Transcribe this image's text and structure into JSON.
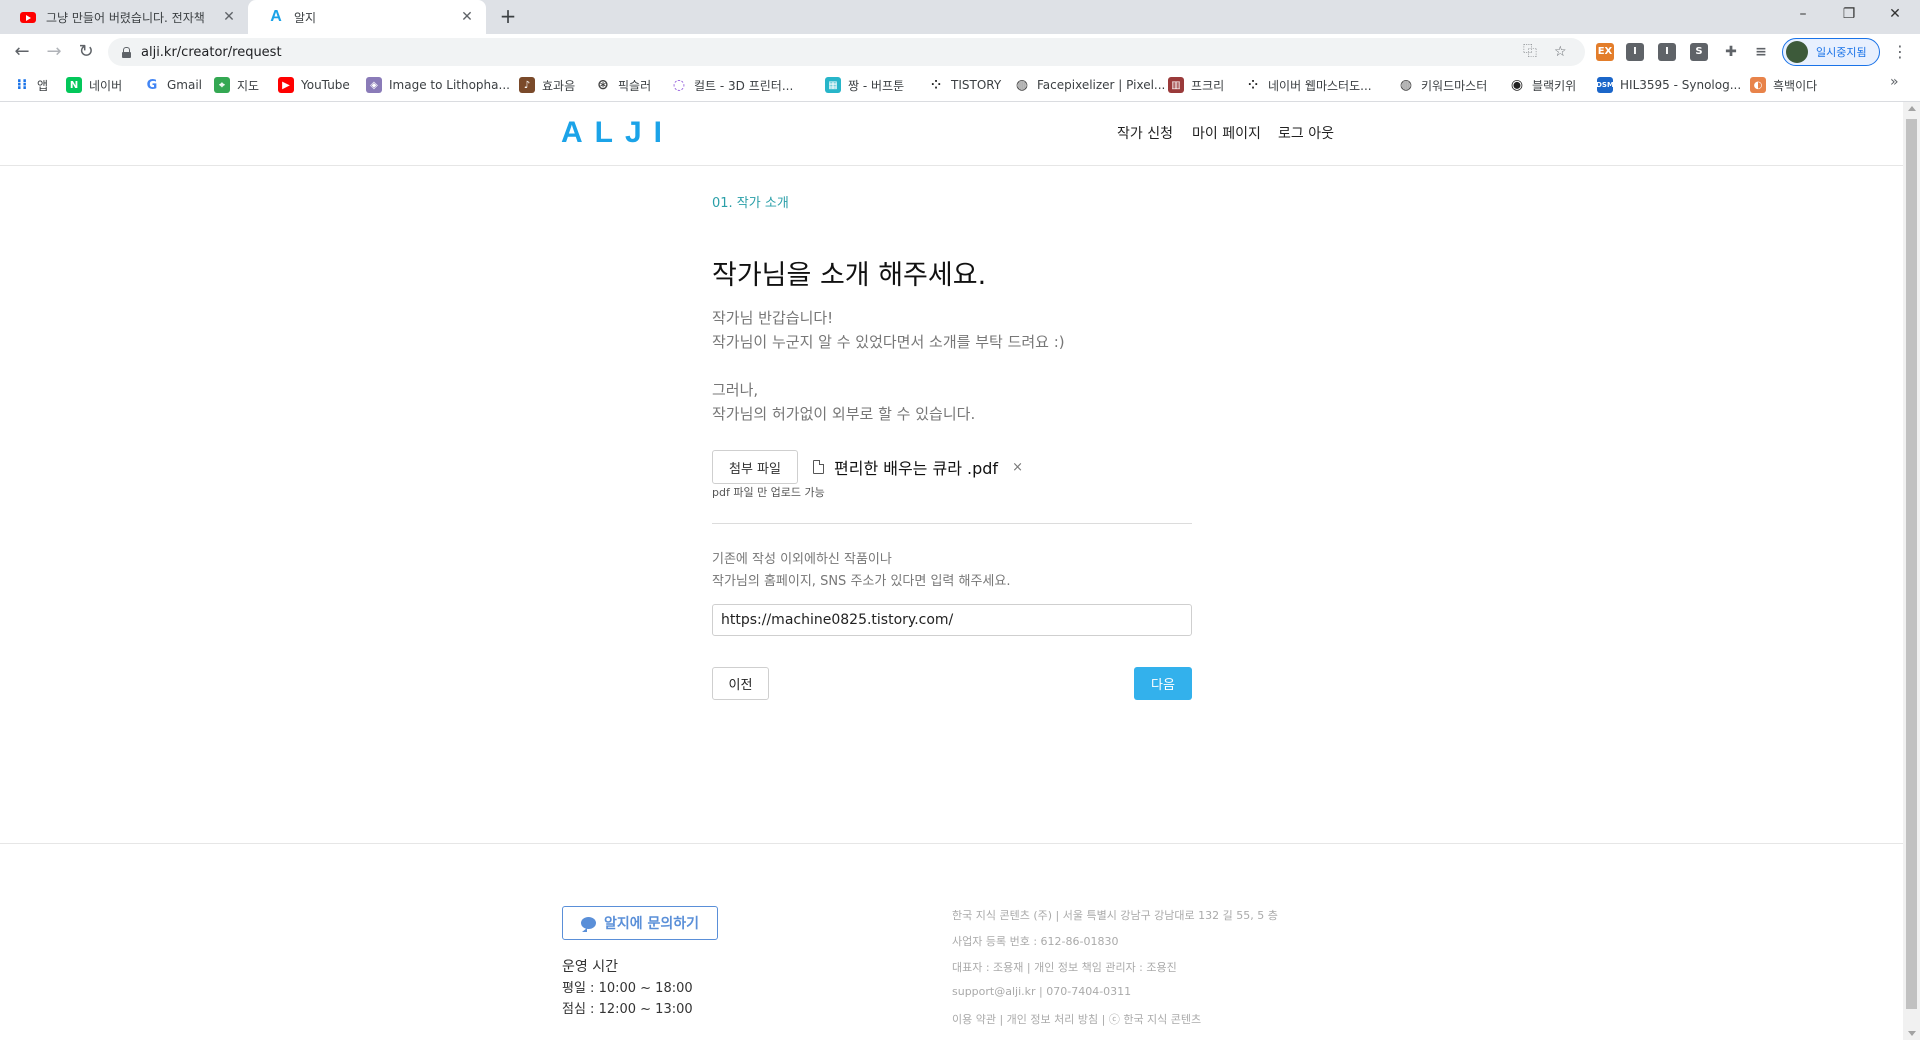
{
  "browser": {
    "tabs": [
      {
        "title": "그냥 만들어 버렸습니다. 전자책",
        "icon": "youtube-icon",
        "active": false
      },
      {
        "title": "알지",
        "icon": "alji-favicon",
        "active": true
      }
    ],
    "url": "alji.kr/creator/request",
    "profile_label": "일시중지됨",
    "bookmarks": [
      {
        "label": "앱",
        "icon": "apps-grid-icon"
      },
      {
        "label": "네이버",
        "icon": "naver-icon"
      },
      {
        "label": "Gmail",
        "icon": "google-icon"
      },
      {
        "label": "지도",
        "icon": "maps-icon"
      },
      {
        "label": "YouTube",
        "icon": "youtube-icon"
      },
      {
        "label": "Image to Lithopha...",
        "icon": "lithophane-icon"
      },
      {
        "label": "효과음",
        "icon": "sound-icon"
      },
      {
        "label": "픽슬러",
        "icon": "pixlr-icon"
      },
      {
        "label": "컬트 - 3D 프린터...",
        "icon": "cult-icon"
      },
      {
        "label": "짱 - 버프툰",
        "icon": "buff-icon"
      },
      {
        "label": "TISTORY",
        "icon": "tistory-icon"
      },
      {
        "label": "Facepixelizer | Pixel...",
        "icon": "globe-icon"
      },
      {
        "label": "프크리",
        "icon": "pkri-icon"
      },
      {
        "label": "네이버 웹마스터도...",
        "icon": "naver-webmaster-icon"
      },
      {
        "label": "키워드마스터",
        "icon": "globe-icon"
      },
      {
        "label": "블랙키위",
        "icon": "blackkiwi-icon"
      },
      {
        "label": "HIL3595 - Synolog...",
        "icon": "dsm-icon"
      },
      {
        "label": "흑백이다",
        "icon": "monochrome-icon"
      }
    ]
  },
  "site": {
    "logo": "ALJI",
    "nav": [
      "작가 신청",
      "마이 페이지",
      "로그 아웃"
    ],
    "brand_color": "#1ba3e8"
  },
  "form": {
    "step": "01. 작가 소개",
    "heading": "작가님을 소개 해주세요.",
    "intro_line1": "작가님 반갑습니다!",
    "intro_line2": "작가님이 누군지 알 수 있었다면서 소개를 부탁 드려요 :)",
    "intro_line3": "그러나,",
    "intro_line4": "작가님의 허가없이 외부로 할 수 있습니다.",
    "attach_label": "첨부 파일",
    "file_name": "편리한 배우는 큐라 .pdf",
    "file_remove": "×",
    "upload_note": "pdf 파일 만 업로드 가능",
    "works_desc_line1": "기존에 작성 이외에하신 작품이나",
    "works_desc_line2": "작가님의 홈페이지, SNS 주소가 있다면 입력 해주세요.",
    "works_url": "https://machine0825.tistory.com/",
    "prev_label": "이전",
    "next_label": "다음",
    "next_color": "#33b1ec"
  },
  "footer": {
    "contact_label": "알지에 문의하기",
    "hours_title": "운영 시간",
    "hours_weekday": "평일 : 10:00 ~ 18:00",
    "hours_lunch": "점심 : 12:00 ~ 13:00",
    "company": "한국 지식 콘텐츠 (주) | 서울 특별시 강남구 강남대로 132 길 55, 5 층",
    "registration": "사업자 등록 번호 : 612-86-01830",
    "ceo": "대표자 : 조용재 | 개인 정보 책임 관리자 : 조용진",
    "contact": "support@alji.kr | 070-7404-0311",
    "legal": "이용 약관 | 개인 정보 처리 방침 | ⓒ 한국 지식 콘텐츠"
  }
}
